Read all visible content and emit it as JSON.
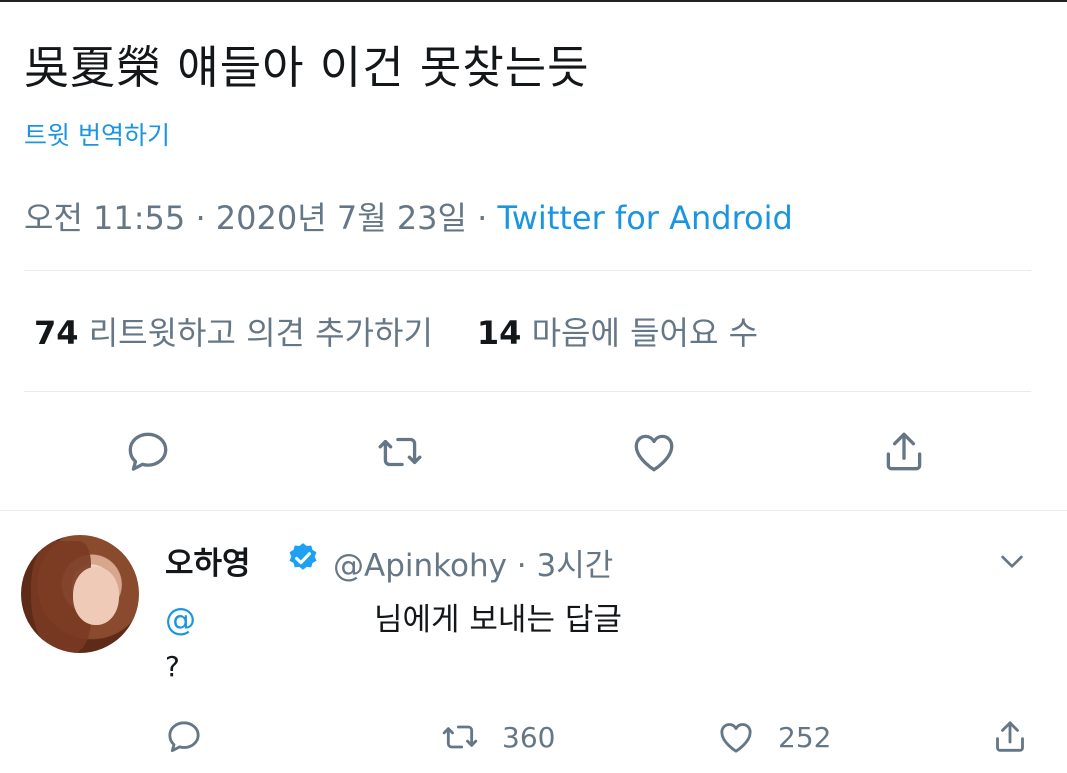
{
  "tweet": {
    "text": "吳夏榮 얘들아 이건 못찾는듯",
    "translate_label": "트윗 번역하기",
    "time": "오전 11:55",
    "sep": " · ",
    "date": "2020년 7월 23일",
    "source": "Twitter for Android"
  },
  "stats": {
    "retweets_count": "74",
    "retweets_label": "리트윗하고 의견 추가하기",
    "likes_count": "14",
    "likes_label": "마음에 들어요 수"
  },
  "actions": {
    "icons": [
      "reply-icon",
      "retweet-icon",
      "like-icon",
      "share-icon"
    ]
  },
  "reply": {
    "name": "오하영",
    "handle": "@Apinkohy",
    "sep": " · ",
    "time": "3시간",
    "reply_to_at": "@",
    "reply_to_text": "님에게 보내는 답글",
    "body": "?",
    "retweet_count": "360",
    "like_count": "252"
  },
  "colors": {
    "accent": "#1b95e0",
    "text": "#14171a",
    "muted": "#657786",
    "divider": "#e6ecf0"
  }
}
